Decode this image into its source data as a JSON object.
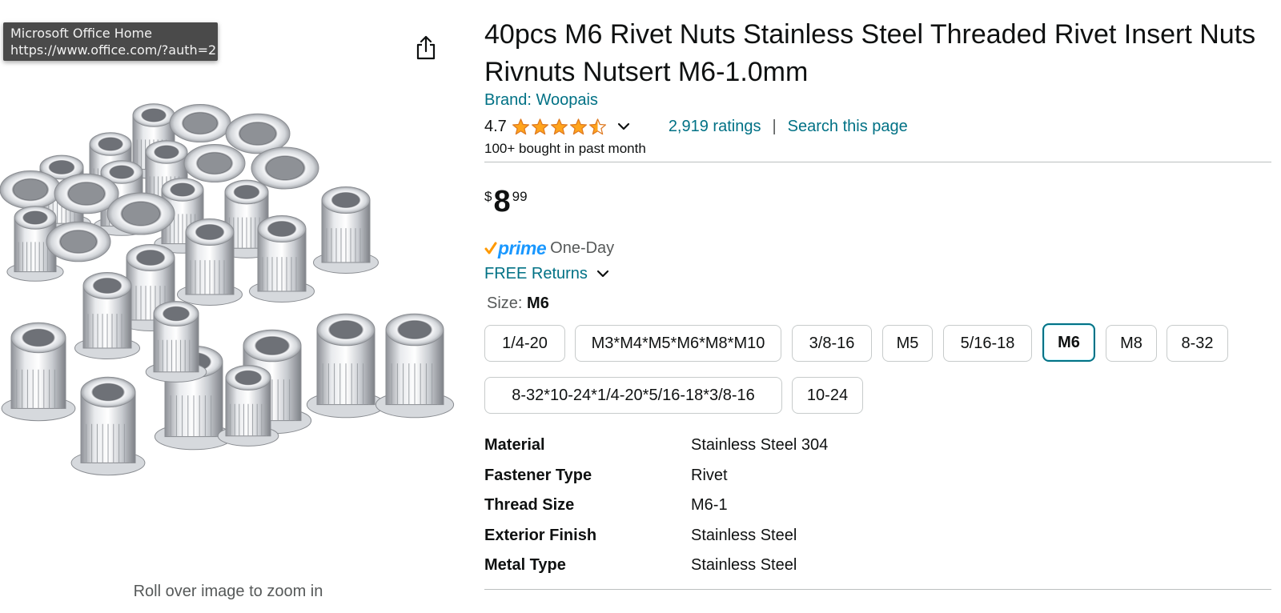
{
  "tooltip": {
    "title": "Microsoft Office Home",
    "url": "https://www.office.com/?auth=2"
  },
  "icons": {
    "share": "share-icon",
    "star_full": "star-full-icon",
    "star_half": "star-half-icon",
    "chevron": "chevron-down-icon",
    "prime_check": "prime-check-icon"
  },
  "image": {
    "zoom_hint": "Roll over image to zoom in"
  },
  "product": {
    "title": "40pcs M6 Rivet Nuts Stainless Steel Threaded Rivet Insert Nuts Rivnuts Nutsert M6-1.0mm",
    "brand_link": "Brand: Woopais",
    "rating_value": "4.7",
    "rating_stars": 4.5,
    "ratings_count": "2,919 ratings",
    "separator": "|",
    "search_page": "Search this page",
    "bought": "100+ bought in past month"
  },
  "price": {
    "symbol": "$",
    "whole": "8",
    "fraction": "99"
  },
  "delivery": {
    "prime": "prime",
    "prime_speed": "One-Day",
    "returns": "FREE Returns"
  },
  "size": {
    "label": "Size:",
    "selected": "M6",
    "options": [
      "1/4-20",
      "M3*M4*M5*M6*M8*M10",
      "3/8-16",
      "M5",
      "5/16-18",
      "M6",
      "M8",
      "8-32",
      "8-32*10-24*1/4-20*5/16-18*3/8-16",
      "10-24"
    ]
  },
  "specs": [
    {
      "key": "Material",
      "value": "Stainless Steel 304"
    },
    {
      "key": "Fastener Type",
      "value": "Rivet"
    },
    {
      "key": "Thread Size",
      "value": "M6-1"
    },
    {
      "key": "Exterior Finish",
      "value": "Stainless Steel"
    },
    {
      "key": "Metal Type",
      "value": "Stainless Steel"
    }
  ],
  "colors": {
    "link": "#007185",
    "star": "#ffa41c",
    "prime": "#1a98ff",
    "prime_check": "#ff9900",
    "selected_border": "#007185",
    "tooltip_bg": "#4a4a4a"
  }
}
